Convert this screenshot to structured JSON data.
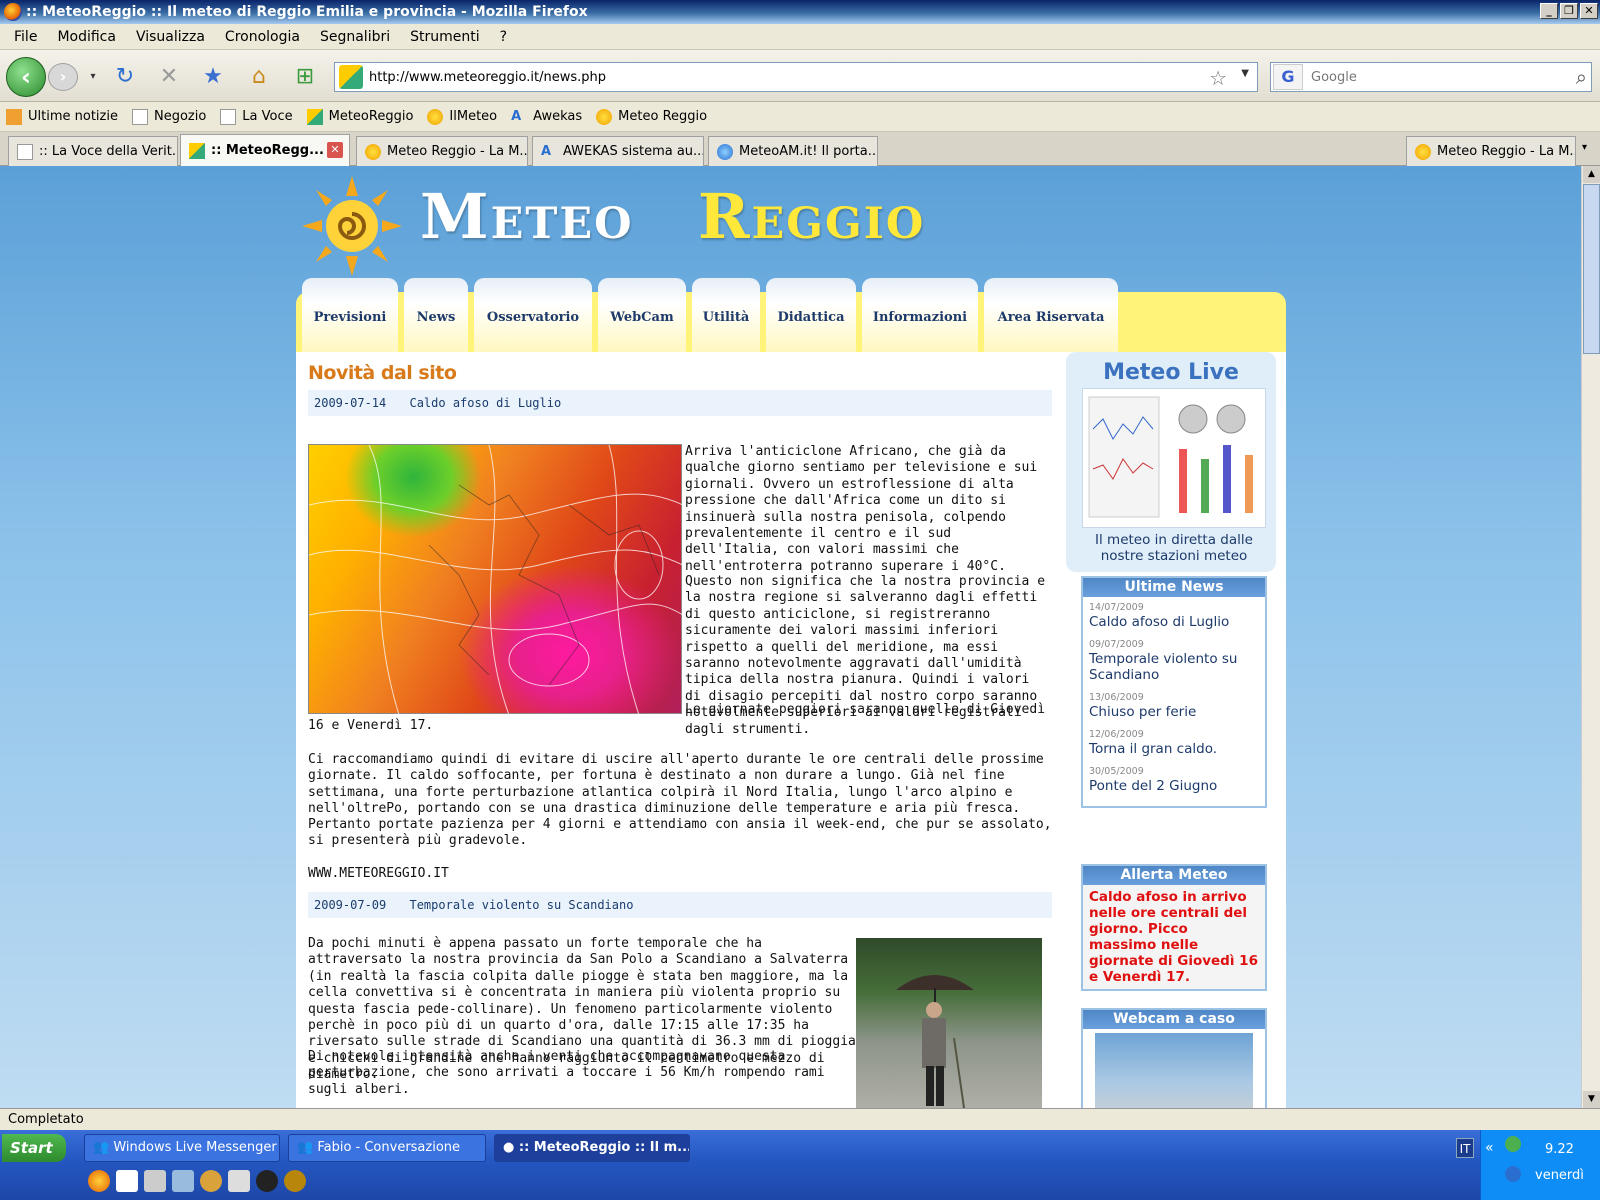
{
  "window": {
    "title": ":: MeteoReggio :: Il meteo di Reggio Emilia e provincia - Mozilla Firefox"
  },
  "menu": [
    "File",
    "Modifica",
    "Visualizza",
    "Cronologia",
    "Segnalibri",
    "Strumenti",
    "?"
  ],
  "navbar": {
    "url": "http://www.meteoreggio.it/news.php",
    "search_engine": "G",
    "search_placeholder": "Google"
  },
  "bookmarks": [
    "Ultime notizie",
    "Negozio",
    "La Voce",
    "MeteoReggio",
    "IlMeteo",
    "Awekas",
    "Meteo Reggio"
  ],
  "tabs": [
    ":: La Voce della Verit...",
    ":: MeteoRegg...",
    "Meteo Reggio - La M...",
    "AWEKAS sistema au...",
    "MeteoAM.it! Il porta...",
    "Meteo Reggio - La M..."
  ],
  "site": {
    "logo_word1": "Meteo",
    "logo_word2": "Reggio",
    "nav": [
      "Previsioni",
      "News",
      "Osservatorio",
      "WebCam",
      "Utilità",
      "Didattica",
      "Informazioni",
      "Area Riservata"
    ],
    "section_title": "Novità dal sito",
    "news1": {
      "date": "2009-07-14",
      "title": "Caldo afoso di Luglio",
      "p1": "Arriva l'anticiclone Africano, che già da qualche giorno sentiamo per televisione e sui giornali. Ovvero un estroflessione di alta pressione che dall'Africa come un dito si insinuerà sulla nostra penisola, colpendo prevalentemente il centro e il sud dell'Italia, con valori massimi che nell'entroterra potranno superare i 40°C.",
      "p2": "Questo non significa che la nostra provincia e la nostra regione si salveranno dagli effetti di questo anticiclone, si registreranno sicuramente dei valori massimi inferiori rispetto a quelli del meridione, ma essi saranno notevolmente aggravati dall'umidità tipica della nostra pianura. Quindi i valori di disagio percepiti dal nostro corpo saranno notevolmente superiori ai valori registrati dagli strumenti.",
      "p3": "Le giornate peggiori saranno quelle di Giovedì 16 e Venerdì 17.",
      "p4": "Ci raccomandiamo quindi di evitare di uscire all'aperto durante le ore centrali delle prossime giornate. Il caldo soffocante, per fortuna è destinato a non durare a lungo. Già nel fine settimana, una forte perturbazione atlantica colpirà il Nord Italia, lungo l'arco alpino e nell'oltrePo, portando con se una drastica diminuzione delle temperature e aria più fresca.",
      "p5": "Pertanto portate pazienza per 4 giorni e attendiamo con ansia il week-end, che pur se assolato, si presenterà più gradevole.",
      "sign": "WWW.METEOREGGIO.IT"
    },
    "news2": {
      "date": "2009-07-09",
      "title": "Temporale violento su Scandiano",
      "p1": "Da pochi minuti è appena passato un forte temporale che ha attraversato la nostra provincia da San Polo a Scandiano a Salvaterra (in realtà la fascia colpita dalle piogge è stata ben maggiore, ma la cella convettiva si è concentrata in maniera più violenta proprio su questa fascia pede-collinare). Un fenomeno particolarmente violento perchè in poco più di un quarto d'ora, dalle 17:15 alle 17:35 ha riversato sulle strade di Scandiano una quantità di 36.3 mm di pioggia e chicchi di grandine che hanno raggiunto il centimetro e mezzo di diametro.",
      "p2": "Di notevole intensità anche i venti che accompagnavano questa perturbazione, che sono arrivati a toccare i 56 Km/h rompendo rami sugli alberi."
    },
    "side": {
      "live_title": "Meteo Live",
      "live_caption": "Il meteo in diretta dalle nostre stazioni meteo",
      "news_title": "Ultime News",
      "news": [
        {
          "d": "14/07/2009",
          "t": "Caldo afoso di Luglio"
        },
        {
          "d": "09/07/2009",
          "t": "Temporale violento su Scandiano"
        },
        {
          "d": "13/06/2009",
          "t": "Chiuso per ferie"
        },
        {
          "d": "12/06/2009",
          "t": "Torna il gran caldo."
        },
        {
          "d": "30/05/2009",
          "t": "Ponte del 2 Giugno"
        }
      ],
      "alert_title": "Allerta Meteo",
      "alert_text": "Caldo afoso in arrivo nelle ore centrali del giorno. Picco massimo nelle giornate di Giovedì 16 e Venerdì 17.",
      "webcam_title": "Webcam a caso"
    }
  },
  "status": "Completato",
  "taskbar": {
    "start": "Start",
    "buttons": [
      "Windows Live Messenger",
      "Fabio - Conversazione",
      ":: MeteoReggio :: Il m..."
    ],
    "lang": "IT",
    "time": "9.22",
    "day": "venerdì"
  }
}
